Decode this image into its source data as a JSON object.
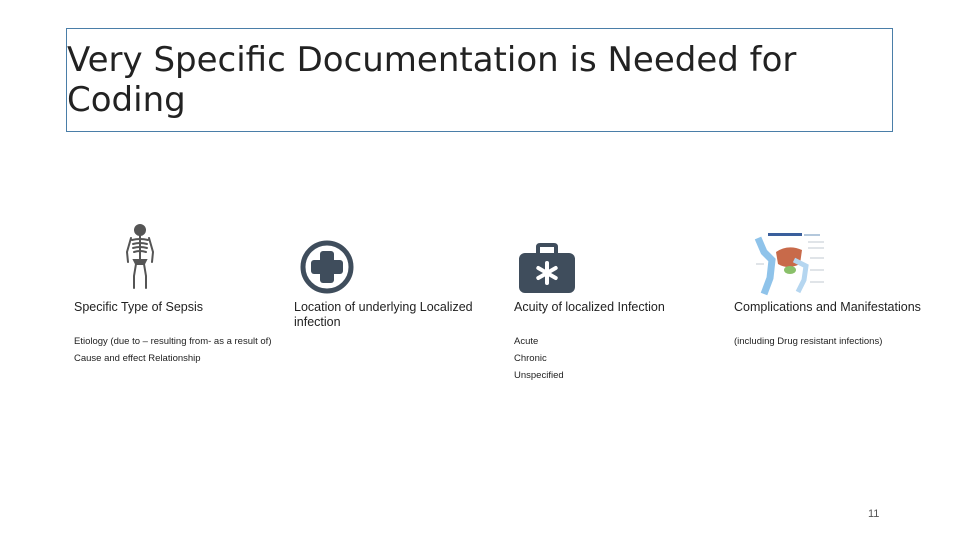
{
  "title": "Very Specific Documentation is Needed for Coding",
  "columns": [
    {
      "icon": "skeleton-icon",
      "heading": "Specific Type of Sepsis",
      "items": [
        "Etiology (due to – resulting from- as a result of)",
        "Cause and effect Relationship"
      ]
    },
    {
      "icon": "medical-cross-icon",
      "heading": "Location  of underlying Localized infection",
      "items": []
    },
    {
      "icon": "medical-kit-icon",
      "heading": "Acuity of localized Infection",
      "items": [
        "Acute",
        "Chronic",
        "Unspecified"
      ]
    },
    {
      "icon": "anatomy-diagram-icon",
      "heading": "Complications and Manifestations",
      "items": [
        "(including Drug resistant infections)"
      ]
    }
  ],
  "page_number": "11",
  "colors": {
    "border": "#4a7ea8",
    "icon": "#3f4d5c"
  }
}
